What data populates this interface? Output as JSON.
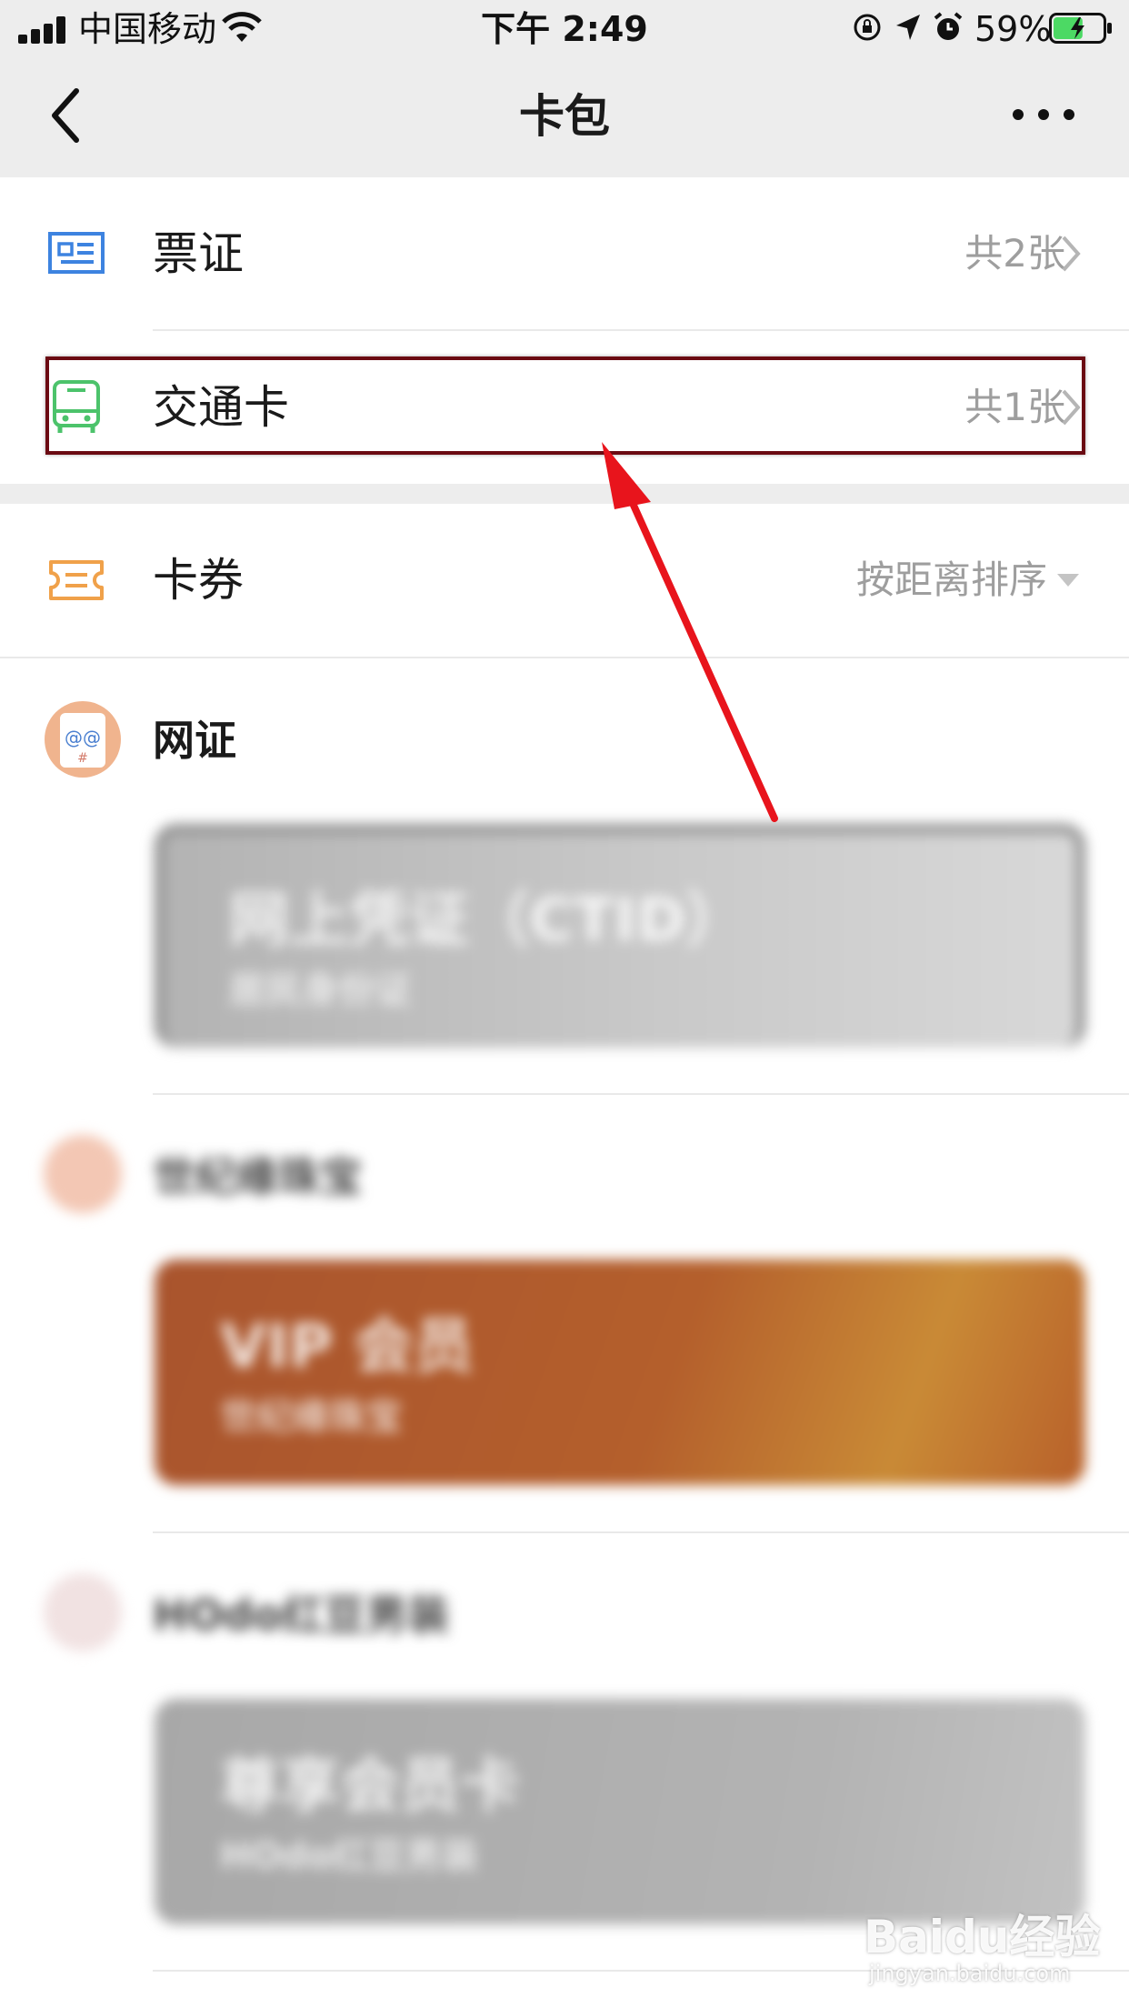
{
  "status_bar": {
    "carrier": "中国移动",
    "time": "下午 2:49",
    "battery_percent": "59%",
    "battery_level": 0.59
  },
  "nav": {
    "title": "卡包"
  },
  "rows": [
    {
      "label": "票证",
      "meta": "共2张",
      "icon": "ticket-id-icon",
      "icon_color": "#3d83e0"
    },
    {
      "label": "交通卡",
      "meta": "共1张",
      "icon": "bus-icon",
      "icon_color": "#4cc36b"
    },
    {
      "label": "卡券",
      "meta": "按距离排序",
      "icon": "coupon-icon",
      "icon_color": "#f0a14a"
    }
  ],
  "merchants": [
    {
      "name": "网证",
      "card_title": "网上凭证（CTID）",
      "card_subtitle": "居民身份证"
    },
    {
      "name": "世纪缘珠宝",
      "card_title": "VIP 会员",
      "card_subtitle": "世纪缘珠宝"
    },
    {
      "name": "HOdo红豆男装",
      "card_title": "尊享会员卡",
      "card_subtitle": "HOdo红豆男装"
    }
  ],
  "annotation": {
    "highlight_color": "#6b0a12",
    "arrow_color": "#e8141c"
  },
  "watermark": {
    "brand": "Baidu经验",
    "url": "jingyan.baidu.com"
  }
}
